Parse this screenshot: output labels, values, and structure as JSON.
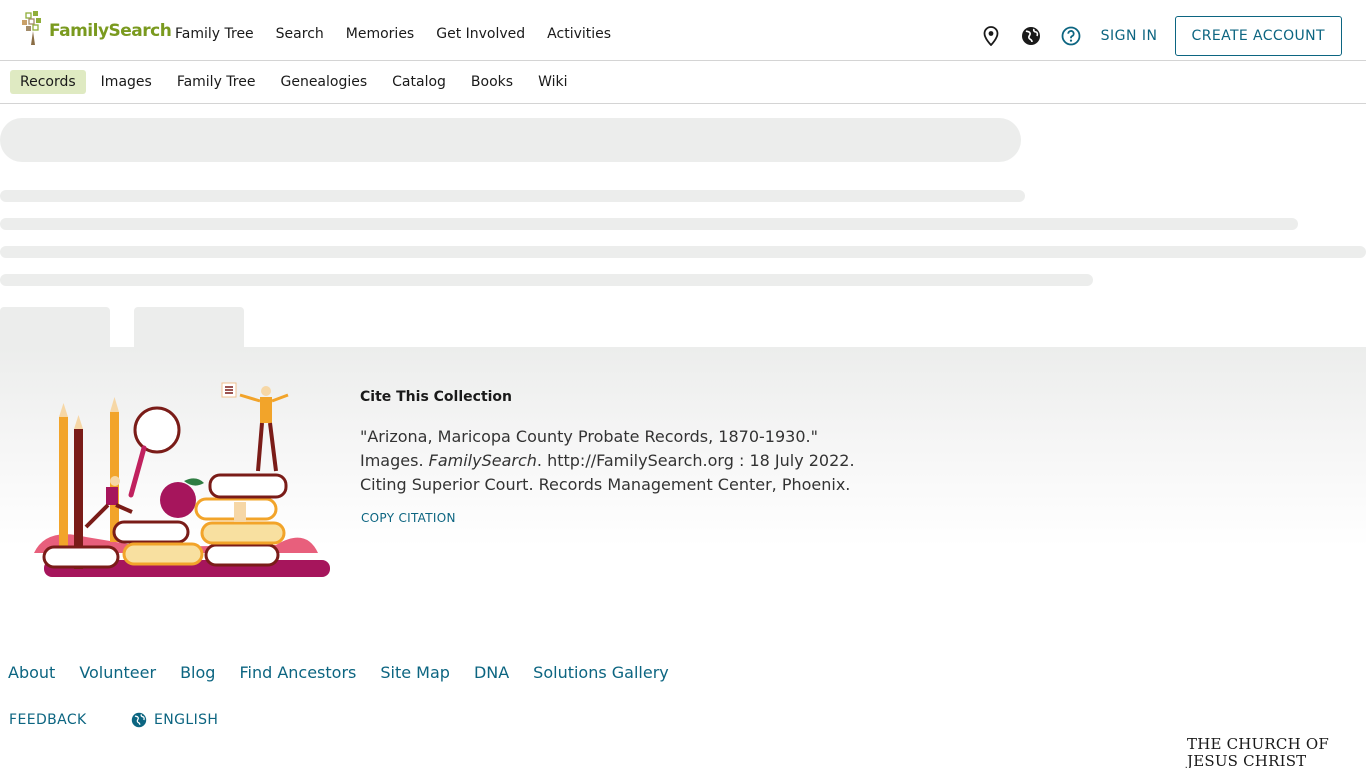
{
  "header": {
    "logo_text": "FamilySearch",
    "main_nav": [
      "Family Tree",
      "Search",
      "Memories",
      "Get Involved",
      "Activities"
    ],
    "sign_in": "SIGN IN",
    "create_account": "CREATE ACCOUNT",
    "accent_color": "#0c6581",
    "brand_color": "#7a9a1f"
  },
  "subnav": {
    "items": [
      "Records",
      "Images",
      "Family Tree",
      "Genealogies",
      "Catalog",
      "Books",
      "Wiki"
    ],
    "active": "Records"
  },
  "citation": {
    "title": "Cite This Collection",
    "line1": "\"Arizona, Maricopa County Probate Records, 1870-1930.\"",
    "line2_prefix": "Images. ",
    "line2_italic": "FamilySearch",
    "line2_suffix": ". http://FamilySearch.org : 18 July 2022.",
    "line3": "Citing Superior Court. Records Management Center, Phoenix.",
    "copy_label": "COPY CITATION"
  },
  "footer": {
    "links": [
      "About",
      "Volunteer",
      "Blog",
      "Find Ancestors",
      "Site Map",
      "DNA",
      "Solutions Gallery"
    ],
    "feedback": "FEEDBACK",
    "language": "ENGLISH",
    "church_line1": "THE CHURCH OF",
    "church_line2": "JESUS CHRIST"
  }
}
